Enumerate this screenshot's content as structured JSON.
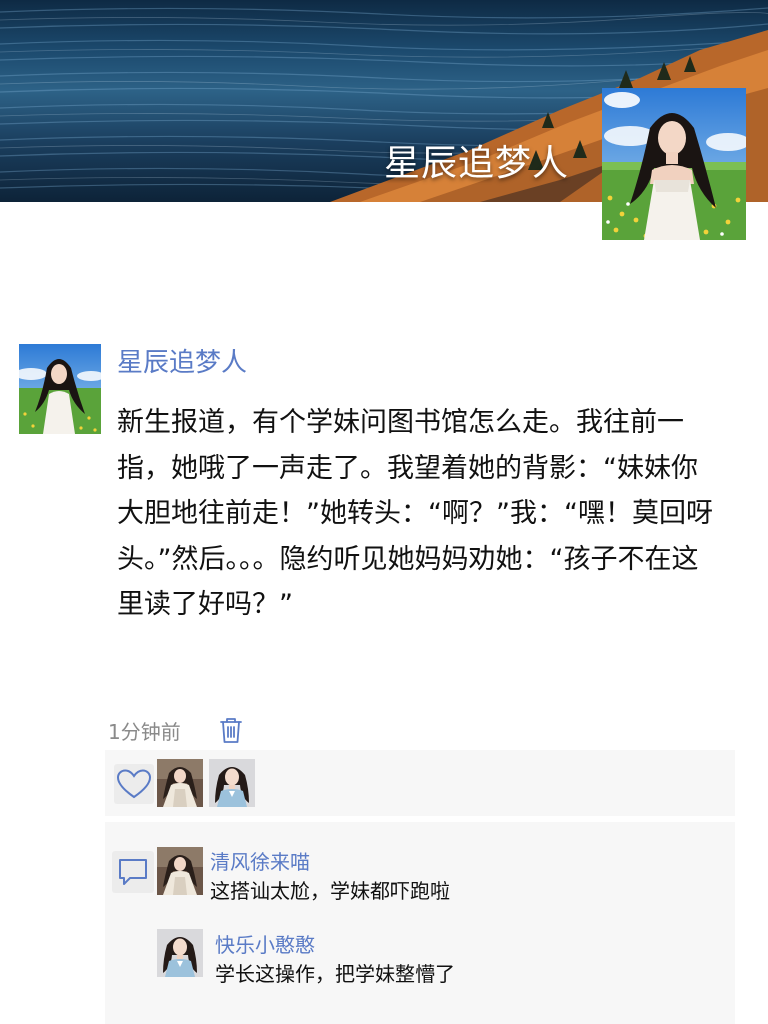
{
  "cover": {
    "title": "星辰追梦人"
  },
  "profile": {
    "avatar_icon": "girl-in-meadow-avatar"
  },
  "post": {
    "author": "星辰追梦人",
    "text": "新生报道，有个学妹问图书馆怎么走。我往前一指，她哦了一声走了。我望着她的背影：“妹妹你大胆地往前走！”她转头：“啊？”我：“嘿！莫回呀头。”然后。。。隐约听见她妈妈劝她：“孩子不在这里读了好吗？”",
    "time": "1分钟前"
  },
  "likes": {
    "icon": "heart-icon",
    "avatars": [
      "girl-in-white-dress-avatar",
      "girl-in-blue-dress-avatar"
    ]
  },
  "comments": [
    {
      "author": "清风徐来喵",
      "text": "这搭讪太尬，学妹都吓跑啦"
    },
    {
      "author": "快乐小憨憨",
      "text": "学长这操作，把学妹整懵了"
    }
  ],
  "colors": {
    "name_blue": "#5a7bc6",
    "panel_bg": "#f7f7f7",
    "time_gray": "#8a8a8a"
  }
}
